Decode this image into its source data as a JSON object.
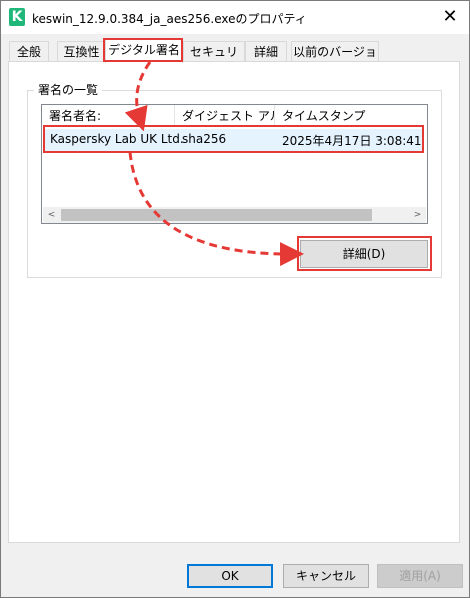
{
  "window": {
    "title": "keswin_12.9.0.384_ja_aes256.exeのプロパティ",
    "app_icon_glyph": "K",
    "close_glyph": "✕"
  },
  "tabs": [
    {
      "label": "全般"
    },
    {
      "label": "互換性"
    },
    {
      "label": "デジタル署名"
    },
    {
      "label": "セキュリティ"
    },
    {
      "label": "詳細"
    },
    {
      "label": "以前のバージョン"
    }
  ],
  "active_tab": "デジタル署名",
  "signature_group": {
    "title": "署名の一覧",
    "columns": [
      "署名者名:",
      "ダイジェスト アル...",
      "タイムスタンプ"
    ],
    "rows": [
      {
        "signer": "Kaspersky Lab UK Ltd.",
        "digest": "sha256",
        "timestamp": "2025年4月17日 3:08:41"
      }
    ],
    "scroll_left": "<",
    "scroll_right": ">"
  },
  "detail_button": {
    "label": "詳細(D)"
  },
  "footer": {
    "ok_label": "OK",
    "cancel_label": "キャンセル",
    "apply_label": "適用(A)"
  },
  "colors": {
    "highlight": "#e53935",
    "selection": "#e5f3ff",
    "icon_green": "#1fb87a"
  }
}
